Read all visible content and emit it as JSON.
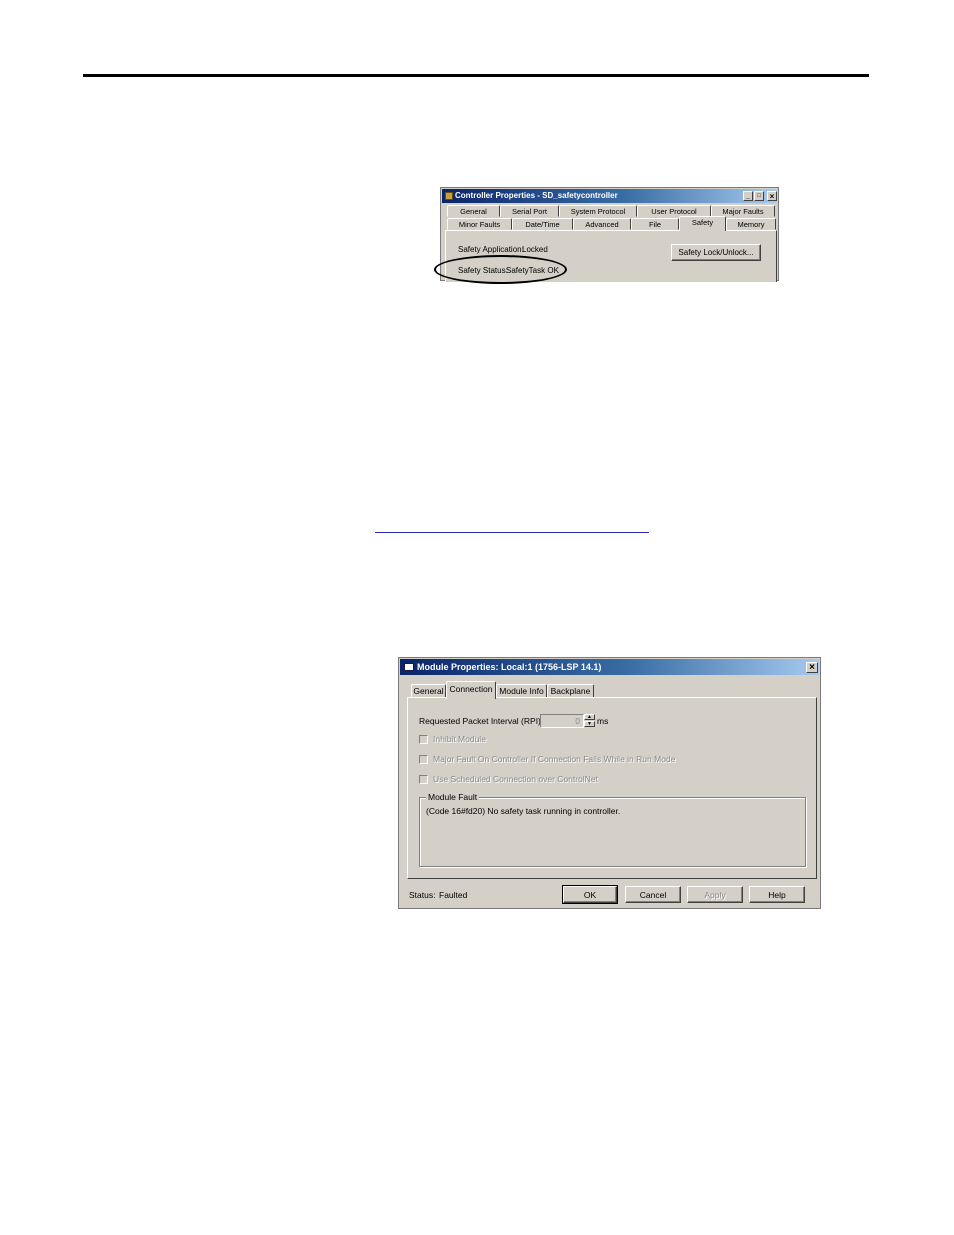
{
  "dialog1": {
    "title": "Controller Properties - SD_safetycontroller",
    "tabs_row1": [
      "General",
      "Serial Port",
      "System Protocol",
      "User Protocol",
      "Major Faults"
    ],
    "tabs_row2": [
      "Minor Faults",
      "Date/Time",
      "Advanced",
      "File",
      "Safety",
      "Memory"
    ],
    "active_tab": "Safety",
    "safety_application_label": "Safety Application:",
    "safety_application_value": "Locked",
    "safety_status_label": "Safety Status:",
    "safety_status_value": "SafetyTask OK",
    "lock_button": "Safety Lock/Unlock..."
  },
  "dialog2": {
    "title": "Module Properties: Local:1 (1756-LSP 14.1)",
    "tabs": [
      "General",
      "Connection",
      "Module Info",
      "Backplane"
    ],
    "active_tab": "Connection",
    "rpi_label": "Requested Packet Interval (RPI):",
    "rpi_value": "0",
    "rpi_unit": "ms",
    "inhibit_module": "Inhibit Module",
    "major_fault": "Major Fault On Controller If Connection Fails While in Run Mode",
    "use_scheduled": "Use Scheduled Connection over ControlNet",
    "module_fault_group": "Module Fault",
    "module_fault_text": "(Code 16#fd20) No safety task running in controller.",
    "status_label": "Status:",
    "status_value": "Faulted",
    "buttons": {
      "ok": "OK",
      "cancel": "Cancel",
      "apply": "Apply",
      "help": "Help"
    }
  }
}
